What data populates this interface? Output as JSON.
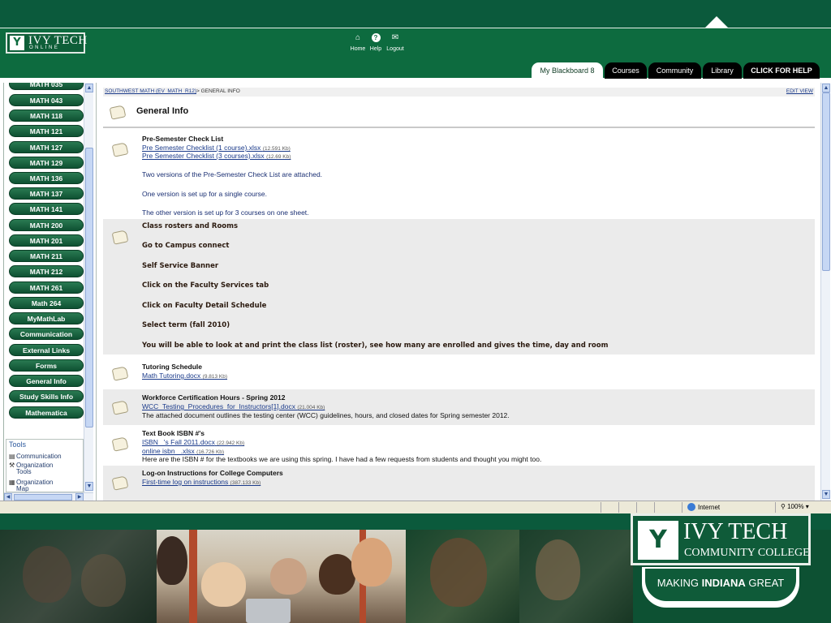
{
  "header": {
    "logo_title": "IVY TECH",
    "logo_sub": "ONLINE",
    "top_links": [
      {
        "icon": "home-icon",
        "label": "Home"
      },
      {
        "icon": "help-icon",
        "label": "Help"
      },
      {
        "icon": "logout-icon",
        "label": "Logout"
      }
    ],
    "tabs": [
      {
        "label": "My Blackboard 8",
        "active": true
      },
      {
        "label": "Courses",
        "active": false
      },
      {
        "label": "Community",
        "active": false
      },
      {
        "label": "Library",
        "active": false
      },
      {
        "label": "CLICK FOR HELP",
        "active": false
      }
    ]
  },
  "nav": {
    "buttons": [
      "MATH 035",
      "MATH 043",
      "MATH 118",
      "MATH 121",
      "MATH 127",
      "MATH 129",
      "MATH 136",
      "MATH 137",
      "MATH 141",
      "MATH 200",
      "MATH 201",
      "MATH 211",
      "MATH 212",
      "MATH 261",
      "Math 264",
      "MyMathLab",
      "Communication",
      "External Links",
      "Forms",
      "General Info",
      "Study Skills Info",
      "Mathematica"
    ],
    "tools_heading": "Tools",
    "tools": [
      {
        "icon": "communication-icon",
        "lines": [
          "Communication"
        ]
      },
      {
        "icon": "organization-tools-icon",
        "lines": [
          "Organization",
          "Tools"
        ]
      },
      {
        "icon": "organization-map-icon",
        "lines": [
          "Organization",
          "Map"
        ]
      }
    ]
  },
  "content": {
    "breadcrumb_link": "SOUTHWEST MATH (EV_MATH_R12)",
    "breadcrumb_rest": "> GENERAL INFO",
    "edit_view": "EDIT VIEW",
    "page_title": "General Info",
    "items": [
      {
        "title": "Pre-Semester Check List",
        "links": [
          {
            "text": "Pre Semester Checklist (1 course).xlsx",
            "size": "(12.591 Kb)"
          },
          {
            "text": "Pre Semester Checklist (3 courses).xlsx",
            "size": "(12.69 Kb)"
          }
        ],
        "texts": [
          "Two versions of the Pre-Semester Check List are attached.",
          "One version is set up for a single course.",
          "The other version is set up for 3 courses on one sheet."
        ]
      },
      {
        "title": "Class rosters and Rooms",
        "lines": [
          "Go to Campus connect",
          "Self Service Banner",
          "Click on the Faculty Services tab",
          "Click on Faculty Detail  Schedule",
          "Select term (fall 2010)",
          "You will be able to look at and print the class list (roster), see how many are enrolled and gives the time, day and room"
        ]
      },
      {
        "title": "Tutoring Schedule",
        "links": [
          {
            "text": "Math Tutoring.docx",
            "size": "(9.813 Kb)"
          }
        ]
      },
      {
        "title": "Workforce Certification Hours - Spring 2012",
        "links": [
          {
            "text": "WCC_Testing_Procedures_for_Instructors[1].docx",
            "size": "(21.004 Kb)"
          }
        ],
        "texts": [
          "The attached document outlines the testing center (WCC) guidelines, hours, and closed dates for Spring semester 2012."
        ]
      },
      {
        "title": "Text Book ISBN #'s",
        "links": [
          {
            "text": "ISBN _'s Fall 2011.docx",
            "size": "(22.942 Kb)"
          },
          {
            "text": "online isbn _.xlsx",
            "size": "(16.726 Kb)"
          }
        ],
        "texts": [
          "Here are the ISBN # for the textbooks we are using this spring. I have had a few requests from students and thought you might too."
        ]
      },
      {
        "title": "Log-on Instructions for College Computers",
        "links": [
          {
            "text": "First-time log on instructions",
            "size": "(387.133 Kb)"
          }
        ]
      }
    ]
  },
  "statusbar": {
    "zone": "Internet",
    "zoom": "100%"
  },
  "branding": {
    "line1": "IVY TECH",
    "line2": "COMMUNITY COLLEGE",
    "tagline_pre": "MAKING ",
    "tagline_bold": "INDIANA",
    "tagline_post": " GREAT"
  }
}
